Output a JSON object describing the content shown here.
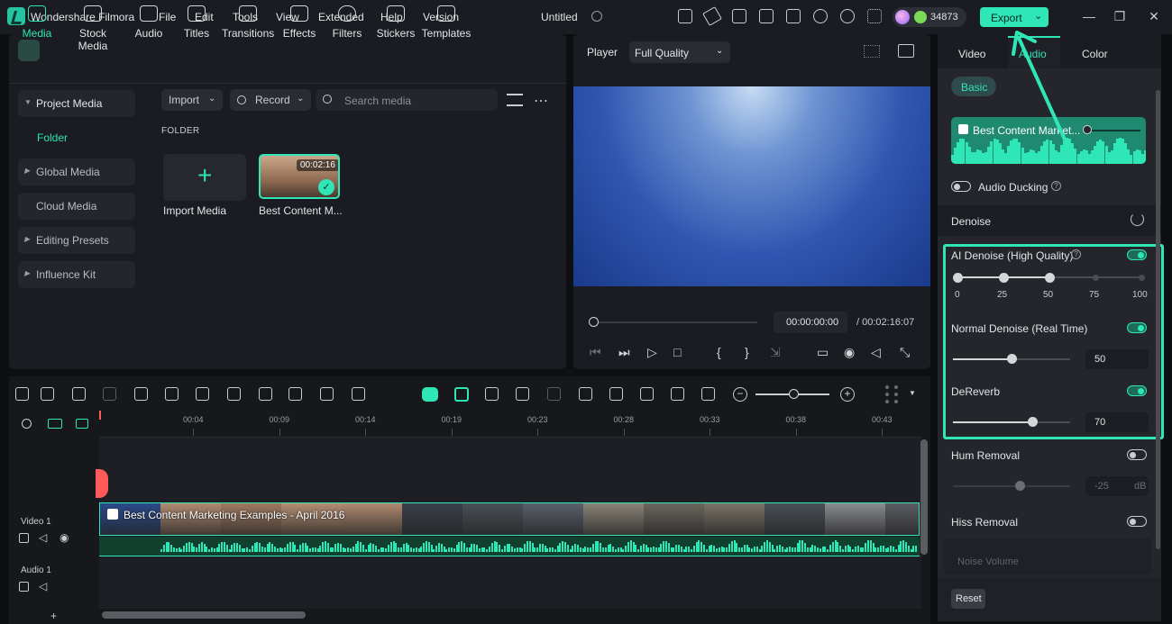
{
  "titlebar": {
    "app_name": "Wondershare Filmora",
    "menu": [
      "File",
      "Edit",
      "Tools",
      "View",
      "Extended",
      "Help",
      "Version"
    ],
    "project_title": "Untitled",
    "credits": "34873",
    "export_label": "Export"
  },
  "media_tabs": [
    {
      "label": "Media",
      "icon": "media-icon"
    },
    {
      "label": "Stock Media",
      "icon": "stock-media-icon"
    },
    {
      "label": "Audio",
      "icon": "music-note-icon"
    },
    {
      "label": "Titles",
      "icon": "text-t-icon"
    },
    {
      "label": "Transitions",
      "icon": "transitions-icon"
    },
    {
      "label": "Effects",
      "icon": "sparkle-icon"
    },
    {
      "label": "Filters",
      "icon": "filters-icon"
    },
    {
      "label": "Stickers",
      "icon": "sticker-icon"
    },
    {
      "label": "Templates",
      "icon": "templates-icon"
    }
  ],
  "sidebar": {
    "items": [
      {
        "label": "Project Media",
        "expanded": true
      },
      {
        "label": "Folder"
      },
      {
        "label": "Global Media"
      },
      {
        "label": "Cloud Media"
      },
      {
        "label": "Editing Presets"
      },
      {
        "label": "Influence Kit"
      }
    ]
  },
  "media_toolbar": {
    "import_label": "Import",
    "record_label": "Record",
    "search_placeholder": "Search media"
  },
  "folder": {
    "heading": "FOLDER",
    "import_tile_label": "Import Media",
    "clip": {
      "label": "Best Content M...",
      "duration": "00:02:16"
    }
  },
  "player": {
    "label": "Player",
    "quality": "Full Quality",
    "current_time": "00:00:00:00",
    "total_time": "/ 00:02:16:07"
  },
  "right_panel": {
    "tabs": [
      "Video",
      "Audio",
      "Color"
    ],
    "active_tab": "Audio",
    "basic_label": "Basic",
    "audio_clip_name": "Best Content Market...",
    "audio_ducking": "Audio Ducking",
    "denoise_heading": "Denoise",
    "ai_denoise": "AI Denoise (High Quality)",
    "ai_denoise_ticks": [
      "0",
      "25",
      "50",
      "75",
      "100"
    ],
    "ai_denoise_value": 50,
    "normal_denoise": "Normal Denoise (Real Time)",
    "normal_denoise_value": "50",
    "dereverb": "DeReverb",
    "dereverb_value": "70",
    "hum_removal": "Hum Removal",
    "hum_value": "-25",
    "hum_unit": "dB",
    "hiss_removal": "Hiss Removal",
    "noise_volume": "Noise Volume",
    "reset_label": "Reset"
  },
  "timeline": {
    "ruler_ticks": [
      "00:04",
      "00:09",
      "00:14",
      "00:19",
      "00:23",
      "00:28",
      "00:33",
      "00:38",
      "00:43"
    ],
    "video_track": "Video 1",
    "audio_track": "Audio 1",
    "video_clip_label": "Best Content Marketing Examples - April 2016"
  },
  "colors": {
    "accent": "#2ee6b6",
    "panel": "#1a1c21",
    "background": "#0e0f13"
  }
}
